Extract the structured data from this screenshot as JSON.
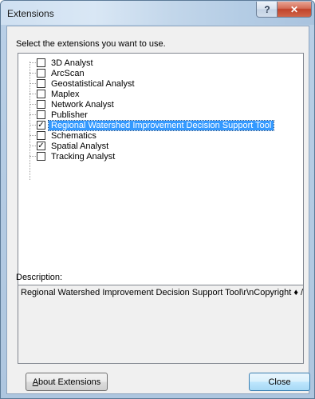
{
  "window": {
    "title": "Extensions",
    "help_glyph": "?",
    "close_glyph": "✕"
  },
  "prompt": "Select the extensions you want to use.",
  "extensions": [
    {
      "label": "3D Analyst",
      "checked": false,
      "selected": false
    },
    {
      "label": "ArcScan",
      "checked": false,
      "selected": false
    },
    {
      "label": "Geostatistical Analyst",
      "checked": false,
      "selected": false
    },
    {
      "label": "Maplex",
      "checked": false,
      "selected": false
    },
    {
      "label": "Network Analyst",
      "checked": false,
      "selected": false
    },
    {
      "label": "Publisher",
      "checked": false,
      "selected": false
    },
    {
      "label": "Regional Watershed Improvement Decision Support Tool",
      "checked": true,
      "selected": true
    },
    {
      "label": "Schematics",
      "checked": false,
      "selected": false
    },
    {
      "label": "Spatial Analyst",
      "checked": true,
      "selected": false
    },
    {
      "label": "Tracking Analyst",
      "checked": false,
      "selected": false
    }
  ],
  "check_glyph": "✓",
  "description": {
    "label": "Description:",
    "text": "Regional Watershed Improvement Decision Support Tool\\r\\nCopyright ♦ /"
  },
  "buttons": {
    "about_accel": "A",
    "about_rest": "bout Extensions",
    "close": "Close"
  },
  "colors": {
    "selection": "#3399ff",
    "title_close": "#c0432a"
  }
}
